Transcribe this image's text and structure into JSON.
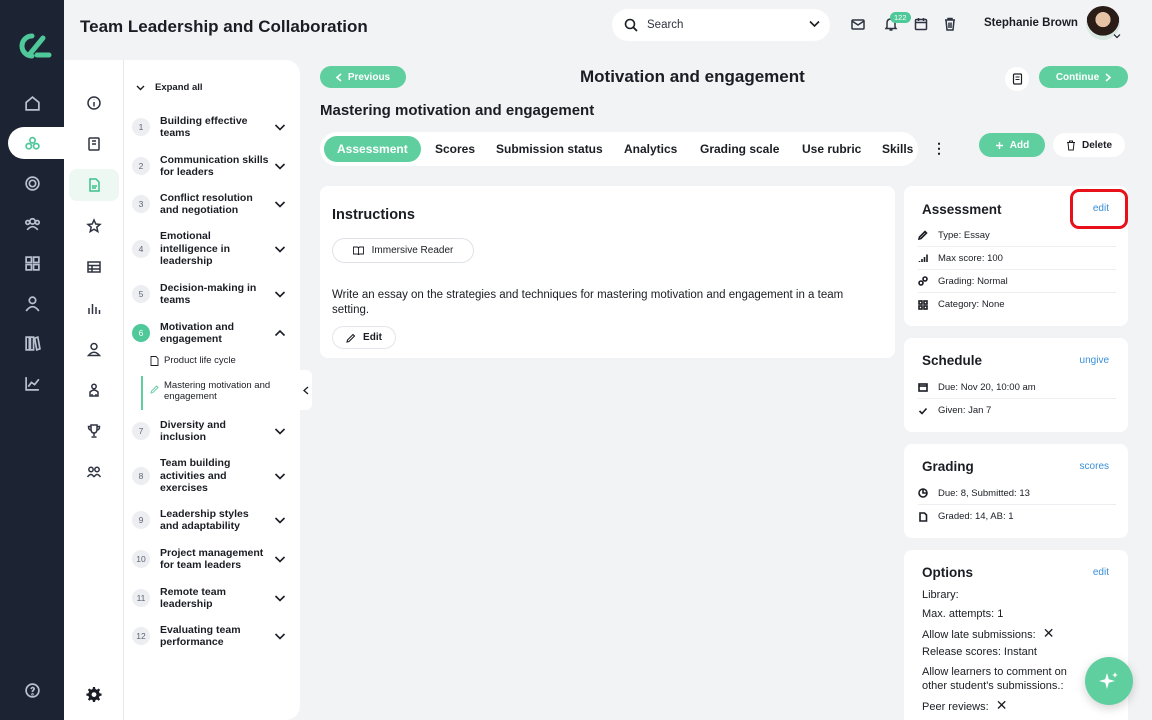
{
  "app": {
    "title": "Team Leadership and Collaboration"
  },
  "search": {
    "placeholder": "Search"
  },
  "notifications": {
    "count": "122"
  },
  "user": {
    "name": "Stephanie Brown"
  },
  "lessons": {
    "expand_all": "Expand all",
    "items": [
      {
        "num": "1",
        "title": "Building effective teams"
      },
      {
        "num": "2",
        "title": "Communication skills for leaders"
      },
      {
        "num": "3",
        "title": "Conflict resolution and negotiation"
      },
      {
        "num": "4",
        "title": "Emotional intelligence in leadership"
      },
      {
        "num": "5",
        "title": "Decision-making in teams"
      },
      {
        "num": "6",
        "title": "Motivation and engagement"
      },
      {
        "num": "7",
        "title": "Diversity and inclusion"
      },
      {
        "num": "8",
        "title": "Team building activities and exercises"
      },
      {
        "num": "9",
        "title": "Leadership styles and adaptability"
      },
      {
        "num": "10",
        "title": "Project management for team leaders"
      },
      {
        "num": "11",
        "title": "Remote team leadership"
      },
      {
        "num": "12",
        "title": "Evaluating team performance"
      }
    ],
    "subitems": [
      {
        "title": "Product life cycle"
      },
      {
        "title": "Mastering motivation and engagement"
      }
    ]
  },
  "header": {
    "previous": "Previous",
    "title": "Motivation and engagement",
    "continue": "Continue",
    "subtitle": "Mastering motivation and engagement"
  },
  "tabs": [
    "Assessment",
    "Scores",
    "Submission status",
    "Analytics",
    "Grading scale",
    "Use rubric",
    "Skills"
  ],
  "actions": {
    "add": "Add",
    "delete": "Delete"
  },
  "instructions": {
    "title": "Instructions",
    "reader": "Immersive Reader",
    "text": "Write an essay on the strategies and techniques for mastering motivation and engagement in a team setting.",
    "edit": "Edit"
  },
  "assessment": {
    "title": "Assessment",
    "link": "edit",
    "rows": [
      "Type: Essay",
      "Max score: 100",
      "Grading: Normal",
      "Category: None"
    ]
  },
  "schedule": {
    "title": "Schedule",
    "link": "ungive",
    "rows": [
      "Due: Nov 20, 10:00 am",
      "Given: Jan 7"
    ]
  },
  "grading": {
    "title": "Grading",
    "link": "scores",
    "rows": [
      "Due: 8, Submitted: 13",
      "Graded: 14, AB: 1"
    ]
  },
  "options": {
    "title": "Options",
    "link": "edit",
    "rows": [
      "Library:",
      "Max. attempts: 1",
      "Allow late submissions:",
      "Release scores: Instant",
      "Allow learners to comment on other student's submissions.:",
      "Peer reviews:"
    ]
  },
  "colors": {
    "accent": "#5fcf9f",
    "rail": "#1c2433",
    "highlight": "#e8111a",
    "link": "#3a8fd9"
  }
}
